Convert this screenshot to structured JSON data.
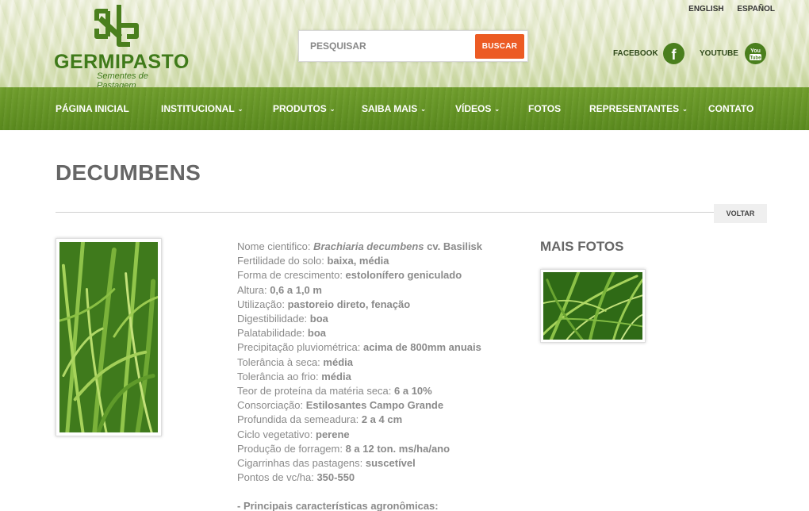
{
  "header": {
    "brand": "GERMIPASTO",
    "tagline": "Sementes de Pastagem",
    "languages": [
      "ENGLISH",
      "ESPAÑOL"
    ],
    "search": {
      "placeholder": "PESQUISAR",
      "button": "BUSCAR"
    },
    "social": [
      {
        "label": "FACEBOOK",
        "icon": "facebook-icon"
      },
      {
        "label": "YOUTUBE",
        "icon": "youtube-icon"
      }
    ]
  },
  "nav": [
    {
      "label": "PÁGINA INICIAL",
      "dropdown": false
    },
    {
      "label": "INSTITUCIONAL",
      "dropdown": true
    },
    {
      "label": "PRODUTOS",
      "dropdown": true
    },
    {
      "label": "SAIBA MAIS",
      "dropdown": true
    },
    {
      "label": "VÍDEOS",
      "dropdown": true
    },
    {
      "label": "FOTOS",
      "dropdown": false
    },
    {
      "label": "REPRESENTANTES",
      "dropdown": true
    },
    {
      "label": "CONTATO",
      "dropdown": false
    }
  ],
  "page": {
    "title": "DECUMBENS",
    "back": "VOLTAR",
    "more_photos": "MAIS FOTOS"
  },
  "specs": {
    "scientific": {
      "label": "Nome cientifico: ",
      "value_italic": "Brachiaria decumbens",
      "value": " cv. Basilisk"
    },
    "rows": [
      {
        "label": "Fertilidade do solo: ",
        "value": "baixa, média"
      },
      {
        "label": "Forma de crescimento: ",
        "value": "estolonífero geniculado"
      },
      {
        "label": "Altura: ",
        "value": "0,6 a 1,0 m"
      },
      {
        "label": "Utilização: ",
        "value": "pastoreio direto, fenação"
      },
      {
        "label": "Digestibilidade: ",
        "value": "boa"
      },
      {
        "label": "Palatabilidade: ",
        "value": "boa"
      },
      {
        "label": "Precipitação pluviométrica: ",
        "value": "acima de 800mm anuais"
      },
      {
        "label": "Tolerância à seca: ",
        "value": "média"
      },
      {
        "label": "Tolerância ao frio: ",
        "value": "média"
      },
      {
        "label": "Teor de proteína da matéria seca: ",
        "value": "6 a 10%"
      },
      {
        "label": "Consorciação: ",
        "value": "Estilosantes Campo Grande"
      },
      {
        "label": "Profundida da semeadura: ",
        "value": "2 a 4 cm"
      },
      {
        "label": "Ciclo vegetativo: ",
        "value": "perene"
      },
      {
        "label": "Produção de forragem: ",
        "value": "8 a 12 ton. ms/ha/ano"
      },
      {
        "label": "Cigarrinhas das pastagens: ",
        "value": "suscetível"
      },
      {
        "label": "Pontos de vc/ha: ",
        "value": "350-550"
      }
    ],
    "section_heading": "- Principais características agronômicas:"
  },
  "colors": {
    "brand_green": "#3f7a1a",
    "nav_green": "#5a8a1e",
    "search_button": "#ec5b24"
  }
}
